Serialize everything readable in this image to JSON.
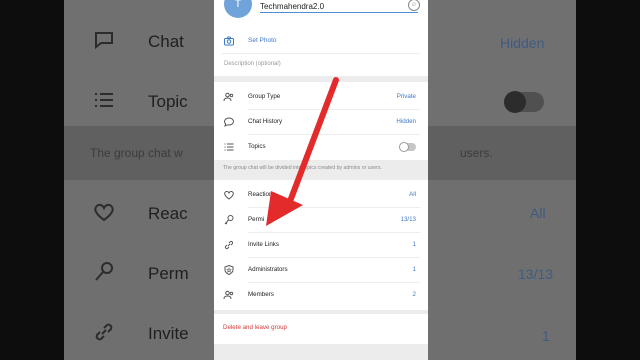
{
  "background": {
    "rows": [
      {
        "label": "Chat",
        "icon": "chat-bubble-icon",
        "value": "Hidden"
      },
      {
        "label": "Topic",
        "icon": "list-icon"
      },
      {
        "label": "Reac",
        "icon": "heart-icon",
        "value": "All"
      },
      {
        "label": "Perm",
        "icon": "key-icon",
        "value": "13/13"
      },
      {
        "label": "Invite",
        "icon": "link-icon",
        "value": "1"
      }
    ],
    "note": "The group chat w",
    "note_right": "users."
  },
  "group": {
    "avatar_letter": "T",
    "name_value": "Techmahendra2.0",
    "set_photo_label": "Set Photo",
    "description_placeholder": "Description (optional)"
  },
  "settings": [
    {
      "label": "Group Type",
      "value": "Private",
      "icon": "people-icon"
    },
    {
      "label": "Chat History",
      "value": "Hidden",
      "icon": "chat-bubble-icon"
    },
    {
      "label": "Topics",
      "icon": "list-icon"
    }
  ],
  "topics_note": "The group chat will be divided into topics created by admins or users.",
  "admin": [
    {
      "label": "Reactions",
      "value": "All",
      "icon": "heart-icon"
    },
    {
      "label": "Permi",
      "value": "13/13",
      "icon": "key-icon"
    },
    {
      "label": "Invite Links",
      "value": "1",
      "icon": "link-icon"
    },
    {
      "label": "Administrators",
      "value": "1",
      "icon": "shield-icon"
    },
    {
      "label": "Members",
      "value": "2",
      "icon": "people-icon"
    }
  ],
  "delete_label": "Delete and leave group",
  "colors": {
    "accent": "#3f79c7",
    "danger": "#d33b3b",
    "arrow": "#e32b2b"
  }
}
